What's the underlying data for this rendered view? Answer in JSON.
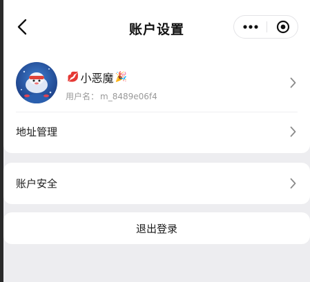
{
  "header": {
    "title": "账户设置",
    "back_icon": "chevron-left-icon",
    "more_icon": "more-dots-icon",
    "close_icon": "target-circle-icon"
  },
  "profile": {
    "emoji_before": "💋",
    "nickname": "小恶魔",
    "emoji_after": "🎉",
    "username_label": "用户名：",
    "username_value": "m_8489e06f4"
  },
  "menu": {
    "address_label": "地址管理",
    "security_label": "账户安全",
    "logout_label": "退出登录"
  },
  "colors": {
    "background": "#ededf0",
    "card": "#ffffff",
    "secondary_text": "#999999",
    "chevron": "#8a8a8a"
  }
}
